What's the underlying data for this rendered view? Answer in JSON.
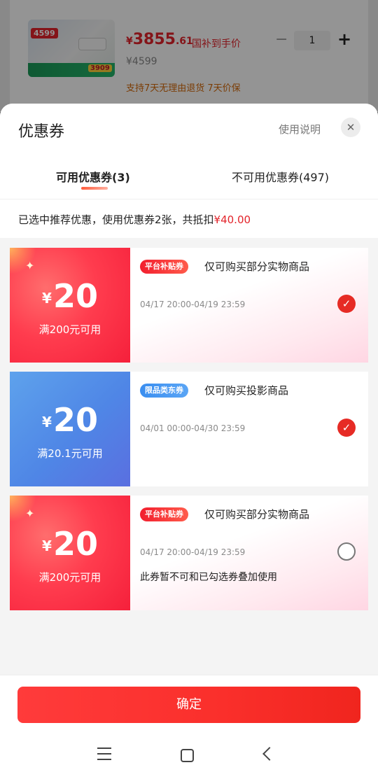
{
  "background": {
    "nav_back_glyph": "<",
    "nav_title": "",
    "product": {
      "thumb_price_tag": "4599",
      "thumb_sale_tag": "3909",
      "price_currency": "¥",
      "price_int": "3855",
      "price_dec": ".61",
      "subsidy_text": "国补到手价",
      "original_price": "¥4599",
      "promise_text": "支持7天无理由退货  7天价保",
      "quantity": "1",
      "minus_glyph": "−",
      "plus_glyph": "+"
    }
  },
  "sheet": {
    "title": "优惠券",
    "help_label": "使用说明",
    "close_glyph": "✕",
    "tabs": [
      {
        "label": "可用优惠券(3)",
        "active": true
      },
      {
        "label": "不可用优惠券(497)",
        "active": false
      }
    ],
    "summary_prefix": "已选中推荐优惠，使用优惠券2张，共抵扣",
    "summary_amount": "¥40.00"
  },
  "coupons": [
    {
      "currency": "¥",
      "value": "20",
      "condition": "满200元可用",
      "badge": "平台补贴券",
      "scope": "仅可购买部分实物商品",
      "validity": "04/17 20:00-04/19 23:59",
      "note": "",
      "selected": true,
      "theme": "red"
    },
    {
      "currency": "¥",
      "value": "20",
      "condition": "满20.1元可用",
      "badge": "限品类东券",
      "scope": "仅可购买投影商品",
      "validity": "04/01 00:00-04/30 23:59",
      "note": "",
      "selected": true,
      "theme": "blue"
    },
    {
      "currency": "¥",
      "value": "20",
      "condition": "满200元可用",
      "badge": "平台补贴券",
      "scope": "仅可购买部分实物商品",
      "validity": "04/17 20:00-04/19 23:59",
      "note": "此券暂不可和已勾选券叠加使用",
      "selected": false,
      "theme": "red"
    }
  ],
  "footer": {
    "confirm_label": "确定"
  },
  "colors": {
    "accent_red": "#e3242b",
    "coupon_blue": "#4f86e6"
  },
  "icons": {
    "check": "check-icon",
    "close": "close-icon"
  }
}
